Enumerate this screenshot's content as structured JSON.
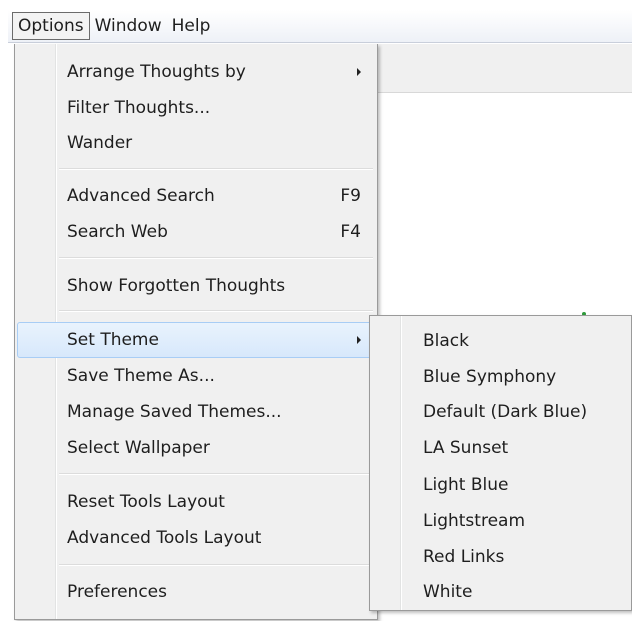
{
  "menubar": {
    "items": [
      {
        "label": "Options"
      },
      {
        "label": "Window"
      },
      {
        "label": "Help"
      }
    ]
  },
  "options_menu": {
    "arrange": "Arrange Thoughts by",
    "filter": "Filter Thoughts...",
    "wander": "Wander",
    "advanced_search": "Advanced Search",
    "advanced_search_shortcut": "F9",
    "search_web": "Search Web",
    "search_web_shortcut": "F4",
    "show_forgotten": "Show Forgotten Thoughts",
    "set_theme": "Set Theme",
    "save_theme": "Save Theme As...",
    "manage_themes": "Manage Saved Themes...",
    "select_wallpaper": "Select Wallpaper",
    "reset_tools": "Reset Tools Layout",
    "advanced_tools": "Advanced Tools Layout",
    "preferences": "Preferences"
  },
  "theme_submenu": {
    "items": [
      "Black",
      "Blue Symphony",
      "Default (Dark Blue)",
      "LA Sunset",
      "Light Blue",
      "Lightstream",
      "Red Links",
      "White"
    ]
  },
  "colors": {
    "menu_bg": "#f0f0f0",
    "highlight": "#d7e8fb",
    "highlight_border": "#a8cdf5"
  }
}
